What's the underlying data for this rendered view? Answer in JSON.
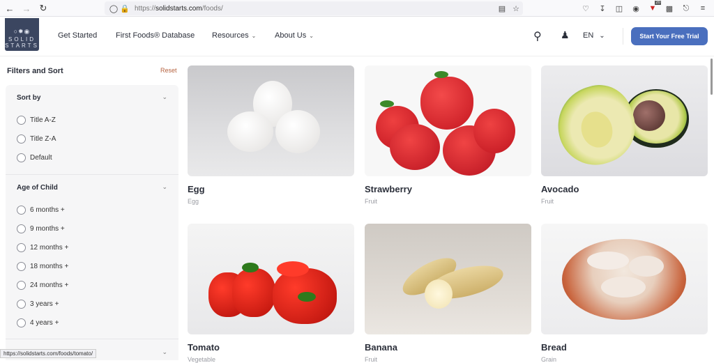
{
  "browser": {
    "url_prefix": "https://",
    "url_domain": "solidstarts.com",
    "url_path": "/foods/",
    "extension_badge": "20",
    "status_url": "https://solidstarts.com/foods/tomato/"
  },
  "header": {
    "logo_line1": "SOLID",
    "logo_line2": "STARTS",
    "nav": [
      {
        "label": "Get Started"
      },
      {
        "label": "First Foods® Database"
      },
      {
        "label": "Resources"
      },
      {
        "label": "About Us"
      }
    ],
    "language": "EN",
    "cta_label": "Start Your Free Trial",
    "cta_color": "#4a6fbe"
  },
  "sidebar": {
    "title": "Filters and Sort",
    "reset_label": "Reset",
    "sort": {
      "heading": "Sort by",
      "options": [
        "Title A-Z",
        "Title Z-A",
        "Default"
      ]
    },
    "age": {
      "heading": "Age of Child",
      "options": [
        "6 months +",
        "9 months +",
        "12 months +",
        "18 months +",
        "24 months +",
        "3 years +",
        "4 years +"
      ]
    }
  },
  "foods": [
    {
      "name": "Egg",
      "category": "Egg"
    },
    {
      "name": "Strawberry",
      "category": "Fruit"
    },
    {
      "name": "Avocado",
      "category": "Fruit"
    },
    {
      "name": "Tomato",
      "category": "Vegetable"
    },
    {
      "name": "Banana",
      "category": "Fruit"
    },
    {
      "name": "Bread",
      "category": "Grain"
    }
  ]
}
